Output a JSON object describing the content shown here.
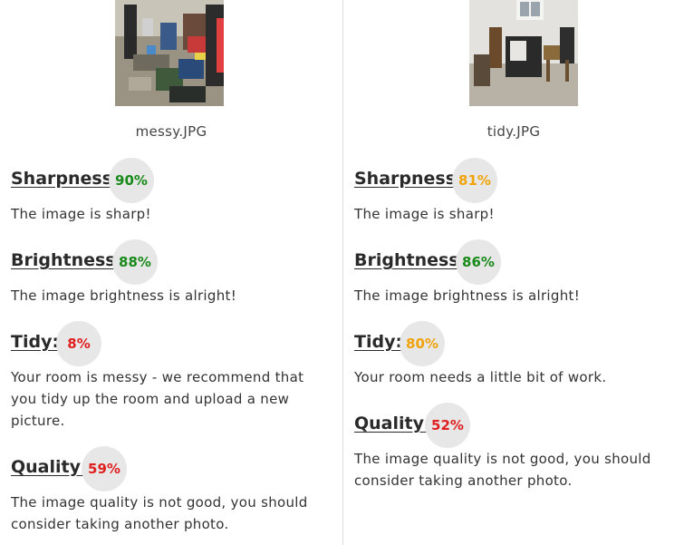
{
  "colors": {
    "good": "#1a8a1a",
    "warn": "#f0a30a",
    "bad": "#e02020"
  },
  "images": [
    {
      "filename": "messy.JPG",
      "sharpness": {
        "label": "Sharpness:",
        "score": "90%",
        "level": "good",
        "desc": "The image is sharp!"
      },
      "brightness": {
        "label": "Brightness:",
        "score": "88%",
        "level": "good",
        "desc": "The image brightness is alright!"
      },
      "tidy": {
        "label": "Tidy:",
        "score": "8%",
        "level": "bad",
        "desc": "Your room is messy - we recommend that you tidy up the room and upload a new picture."
      },
      "quality": {
        "label": "Quality:",
        "score": "59%",
        "level": "bad",
        "desc": "The image quality is not good, you should consider taking another photo."
      }
    },
    {
      "filename": "tidy.JPG",
      "sharpness": {
        "label": "Sharpness:",
        "score": "81%",
        "level": "warn",
        "desc": "The image is sharp!"
      },
      "brightness": {
        "label": "Brightness:",
        "score": "86%",
        "level": "good",
        "desc": "The image brightness is alright!"
      },
      "tidy": {
        "label": "Tidy:",
        "score": "80%",
        "level": "warn",
        "desc": "Your room needs a little bit of work."
      },
      "quality": {
        "label": "Quality:",
        "score": "52%",
        "level": "bad",
        "desc": "The image quality is not good, you should consider taking another photo."
      }
    }
  ]
}
